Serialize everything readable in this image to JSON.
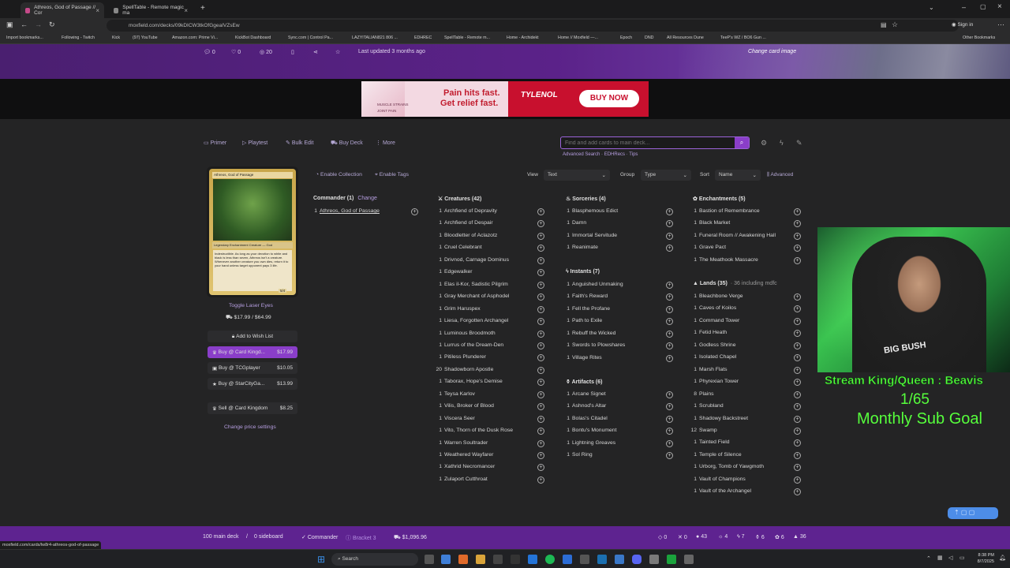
{
  "browser": {
    "tabs": [
      {
        "title": "Athreos, God of Passage // Cor",
        "active": true,
        "color": "#c64a8a"
      },
      {
        "title": "SpellTable - Remote magic ma",
        "active": false,
        "color": "#444444"
      }
    ],
    "url": "moxfield.com/decks/09kDICW3tkOfGgeaIVZsEw",
    "sign_in": "Sign in",
    "bookmarks": [
      "Import bookmarks...",
      "Following - Twitch",
      "Kick",
      "(97) YouTube",
      "Amazon.com: Prime Vi...",
      "KickBot Dashboard",
      "Sync.com | Control Pa...",
      "LAZYITALIAN821 806 ...",
      "EDHREC",
      "SpellTable - Remote m...",
      "Home - Archidekt",
      "Home // Moxfield —...",
      "Epoch",
      "DND",
      "All Resources Dune",
      "TeeP's WZ / BO6 Gun ..."
    ],
    "other_bookmarks": "Other Bookmarks"
  },
  "hero": {
    "comments": "0",
    "likes": "0",
    "views": "20",
    "updated": "Last updated 3 months ago",
    "change_image": "Change card image"
  },
  "ad": {
    "line1": "Pain hits fast.",
    "line2": "Get relief fast.",
    "brand": "TYLENOL",
    "cta": "BUY NOW",
    "tag": "MUSCLE STRAINS",
    "tag2": "JOINT PAIN"
  },
  "toolbar": {
    "primer": "Primer",
    "playtest": "Playtest",
    "bulk_edit": "Bulk Edit",
    "buy_deck": "Buy Deck",
    "more": "More",
    "search_placeholder": "Find and add cards to main deck...",
    "advanced_search": "Advanced Search",
    "edhrecs": "EDHRecs",
    "tips": "Tips",
    "enable_collection": "Enable Collection",
    "enable_tags": "Enable Tags",
    "view_label": "View",
    "view_value": "Text",
    "group_label": "Group",
    "group_value": "Type",
    "sort_label": "Sort",
    "sort_value": "Name",
    "advanced": "Advanced"
  },
  "sidebar": {
    "card_name": "Athreos, God of Passage",
    "card_type": "Legendary Enchantment Creature — God",
    "card_text": "Indestructible. As long as your devotion to white and black is less than seven, Athreos isn't a creature. Whenever another creature you own dies, return it to your hand unless target opponent pays 3 life.",
    "card_pt": "5/4",
    "toggle": "Toggle Laser Eyes",
    "price": "$17.99 / $64.99",
    "wishlist": "Add to Wish List",
    "buy_ck": "Buy @ Card Kingd...",
    "buy_ck_price": "$17.99",
    "buy_tcg": "Buy @ TCGplayer",
    "buy_tcg_price": "$10.05",
    "buy_scg": "Buy @ StarCityGa...",
    "buy_scg_price": "$13.99",
    "sell_ck": "Sell @ Card Kingdom",
    "sell_ck_price": "$8.25",
    "price_settings": "Change price settings"
  },
  "deck": {
    "commander": {
      "title": "Commander (1)",
      "change": "Change",
      "cards": [
        {
          "q": "1",
          "name": "Athreos, God of Passage"
        }
      ]
    },
    "creatures": {
      "title": "Creatures (42)",
      "cards": [
        {
          "q": "1",
          "name": "Archfiend of Depravity"
        },
        {
          "q": "1",
          "name": "Archfiend of Despair"
        },
        {
          "q": "1",
          "name": "Bloodletter of Aclazotz"
        },
        {
          "q": "1",
          "name": "Cruel Celebrant"
        },
        {
          "q": "1",
          "name": "Drivnod, Carnage Dominus"
        },
        {
          "q": "1",
          "name": "Edgewalker"
        },
        {
          "q": "1",
          "name": "Elas il-Kor, Sadistic Pilgrim"
        },
        {
          "q": "1",
          "name": "Gray Merchant of Asphodel"
        },
        {
          "q": "1",
          "name": "Grim Haruspex"
        },
        {
          "q": "1",
          "name": "Liesa, Forgotten Archangel"
        },
        {
          "q": "1",
          "name": "Luminous Broodmoth"
        },
        {
          "q": "1",
          "name": "Lurrus of the Dream-Den"
        },
        {
          "q": "1",
          "name": "Pitiless Plunderer"
        },
        {
          "q": "20",
          "name": "Shadowborn Apostle"
        },
        {
          "q": "1",
          "name": "Taborax, Hope's Demise"
        },
        {
          "q": "1",
          "name": "Teysa Karlov"
        },
        {
          "q": "1",
          "name": "Vilis, Broker of Blood"
        },
        {
          "q": "1",
          "name": "Viscera Seer"
        },
        {
          "q": "1",
          "name": "Vito, Thorn of the Dusk Rose"
        },
        {
          "q": "1",
          "name": "Warren Soultrader"
        },
        {
          "q": "1",
          "name": "Weathered Wayfarer"
        },
        {
          "q": "1",
          "name": "Xathrid Necromancer"
        },
        {
          "q": "1",
          "name": "Zulaport Cutthroat"
        }
      ]
    },
    "sorceries": {
      "title": "Sorceries (4)",
      "cards": [
        {
          "q": "1",
          "name": "Blasphemous Edict"
        },
        {
          "q": "1",
          "name": "Damn"
        },
        {
          "q": "1",
          "name": "Immortal Servitude"
        },
        {
          "q": "1",
          "name": "Reanimate"
        }
      ]
    },
    "instants": {
      "title": "Instants (7)",
      "cards": [
        {
          "q": "1",
          "name": "Anguished Unmaking"
        },
        {
          "q": "1",
          "name": "Faith's Reward"
        },
        {
          "q": "1",
          "name": "Fell the Profane"
        },
        {
          "q": "1",
          "name": "Path to Exile"
        },
        {
          "q": "1",
          "name": "Rebuff the Wicked"
        },
        {
          "q": "1",
          "name": "Swords to Plowshares"
        },
        {
          "q": "1",
          "name": "Village Rites"
        }
      ]
    },
    "artifacts": {
      "title": "Artifacts (6)",
      "cards": [
        {
          "q": "1",
          "name": "Arcane Signet"
        },
        {
          "q": "1",
          "name": "Ashnod's Altar"
        },
        {
          "q": "1",
          "name": "Bolas's Citadel"
        },
        {
          "q": "1",
          "name": "Bontu's Monument"
        },
        {
          "q": "1",
          "name": "Lightning Greaves"
        },
        {
          "q": "1",
          "name": "Sol Ring"
        }
      ]
    },
    "enchantments": {
      "title": "Enchantments (5)",
      "cards": [
        {
          "q": "1",
          "name": "Bastion of Remembrance"
        },
        {
          "q": "1",
          "name": "Black Market"
        },
        {
          "q": "1",
          "name": "Funeral Room // Awakening Hall"
        },
        {
          "q": "1",
          "name": "Grave Pact"
        },
        {
          "q": "1",
          "name": "The Meathook Massacre"
        }
      ]
    },
    "lands": {
      "title": "Lands (35)",
      "sub": "· 36 including mdfc",
      "cards": [
        {
          "q": "1",
          "name": "Bleachbone Verge"
        },
        {
          "q": "1",
          "name": "Caves of Koilos"
        },
        {
          "q": "1",
          "name": "Command Tower"
        },
        {
          "q": "1",
          "name": "Fetid Heath"
        },
        {
          "q": "1",
          "name": "Godless Shrine"
        },
        {
          "q": "1",
          "name": "Isolated Chapel"
        },
        {
          "q": "1",
          "name": "Marsh Flats"
        },
        {
          "q": "1",
          "name": "Phyrexian Tower"
        },
        {
          "q": "8",
          "name": "Plains"
        },
        {
          "q": "1",
          "name": "Scrubland"
        },
        {
          "q": "1",
          "name": "Shadowy Backstreet"
        },
        {
          "q": "12",
          "name": "Swamp"
        },
        {
          "q": "1",
          "name": "Tainted Field"
        },
        {
          "q": "1",
          "name": "Temple of Silence"
        },
        {
          "q": "1",
          "name": "Urborg, Tomb of Yawgmoth"
        },
        {
          "q": "1",
          "name": "Vault of Champions"
        },
        {
          "q": "1",
          "name": "Vault of the Archangel"
        }
      ]
    }
  },
  "overlay": {
    "line1": "Stream King/Queen : Beavis",
    "line2": "1/65",
    "line3": "Monthly Sub Goal",
    "shirt": "BIG BUSH"
  },
  "footer": {
    "main": "100 main deck",
    "sep": "/",
    "side": "0 sideboard",
    "commander": "Commander",
    "bracket": "Bracket 3",
    "price": "$1,096.96",
    "counts": [
      "0",
      "0",
      "43",
      "4",
      "7",
      "6",
      "6",
      "36"
    ]
  },
  "status_link": "moxfield.com/cards/lw8r4-athreos-god-of-passage",
  "taskbar": {
    "search": "Search",
    "time": "8:38 PM",
    "date": "8/7/2025"
  }
}
